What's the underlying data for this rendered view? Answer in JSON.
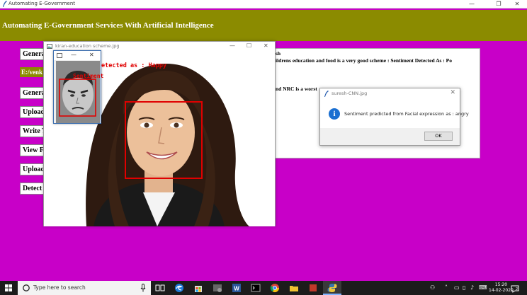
{
  "main_window": {
    "title": "Automating E-Government",
    "minimize": "—",
    "maximize": "❐",
    "close": "✕"
  },
  "header": {
    "title": "Automating E-Government Services With Artificial Intelligence"
  },
  "sidebar": {
    "buttons": [
      "Genera",
      "Genera",
      "Upload",
      "Write T",
      "View F",
      "Upload",
      "Detect"
    ],
    "path_label": "E:/venk"
  },
  "text_area": {
    "lines": [
      "sh",
      "ildrens education and food is a very good scheme : Sentiment Detected As : Po",
      "nd NRC is a worst"
    ]
  },
  "image_window": {
    "title": "kiran-education scheme.jpg",
    "minimize": "—",
    "maximize": "☐",
    "close": "✕",
    "overlay_text": "etected as : Happy"
  },
  "small_window": {
    "minimize": "—",
    "maximize": "☐",
    "close": "✕",
    "overlay_text": "Sentiment"
  },
  "dialog": {
    "title": "suresh-CNN.jpg",
    "close": "✕",
    "message": "Sentiment predicted from Facial expression as : angry",
    "ok_label": "OK"
  },
  "taskbar": {
    "search_placeholder": "Type here to search",
    "time": "15:20",
    "date": "14-02-2020",
    "notification_count": "2"
  },
  "colors": {
    "background": "#c800c8",
    "header_band": "#8b8b00",
    "face_box": "#e00000",
    "info_blue": "#1a6fd1"
  }
}
